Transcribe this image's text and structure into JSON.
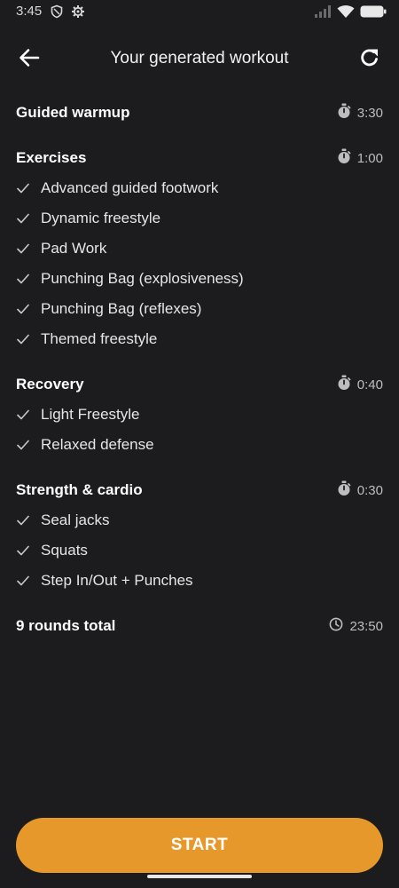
{
  "status_bar": {
    "time": "3:45"
  },
  "header": {
    "title": "Your generated workout"
  },
  "sections": [
    {
      "title": "Guided warmup",
      "duration": "3:30",
      "items": []
    },
    {
      "title": "Exercises",
      "duration": "1:00",
      "items": [
        "Advanced guided footwork",
        "Dynamic freestyle",
        "Pad Work",
        "Punching Bag (explosiveness)",
        "Punching Bag (reflexes)",
        "Themed freestyle"
      ]
    },
    {
      "title": "Recovery",
      "duration": "0:40",
      "items": [
        "Light Freestyle",
        "Relaxed defense"
      ]
    },
    {
      "title": "Strength & cardio",
      "duration": "0:30",
      "items": [
        "Seal jacks",
        "Squats",
        "Step In/Out + Punches"
      ]
    }
  ],
  "total": {
    "label": "9 rounds total",
    "duration": "23:50"
  },
  "start_button": {
    "label": "START"
  },
  "colors": {
    "background": "#1c1c1e",
    "accent": "#e6982b"
  }
}
